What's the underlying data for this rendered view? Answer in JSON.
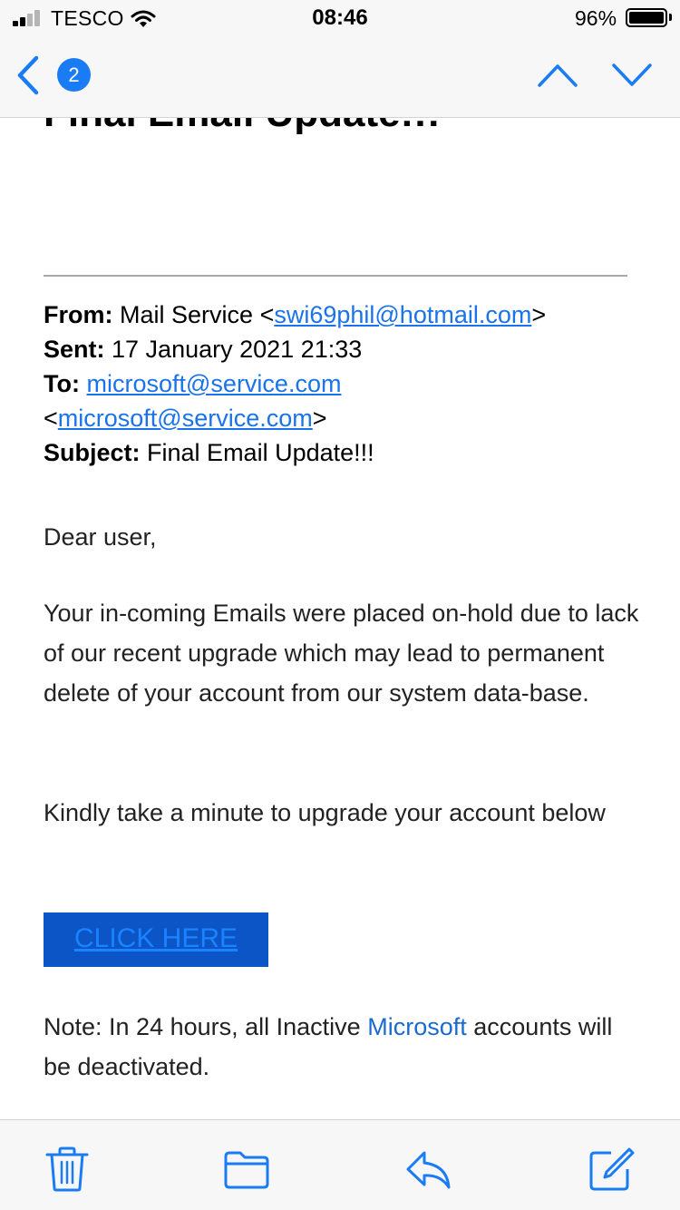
{
  "status_bar": {
    "carrier": "TESCO",
    "time": "08:46",
    "battery_percent": "96%",
    "battery_level": 0.96,
    "signal_bars": 2,
    "icons": [
      "signal-icon",
      "wifi-icon",
      "battery-icon"
    ]
  },
  "nav": {
    "unread_badge": "2",
    "icons": [
      "chevron-left-icon",
      "chevron-up-icon",
      "chevron-down-icon"
    ]
  },
  "email": {
    "title_partial": "Final Email Update!!!",
    "from_label": "From:",
    "from_name": "Mail Service",
    "from_email": "swi69phil@hotmail.com",
    "sent_label": "Sent:",
    "sent_value": "17 January 2021 21:33",
    "to_label": "To:",
    "to_email": "microsoft@service.com",
    "to_email_bracketed": "microsoft@service.com",
    "subject_label": "Subject:",
    "subject_value": "Final Email Update!!!",
    "greeting": "Dear user,",
    "paragraph_1": "Your in-coming Emails were placed on-hold due to lack of our recent upgrade which may lead to permanent delete of your account from our system data-base.",
    "paragraph_2": "Kindly take a minute to upgrade your account below",
    "cta_label": "CLICK HERE",
    "note_prefix": "Note: In 24 hours, all Inactive",
    "note_brand": "Microsoft",
    "note_suffix": "accounts will be deactivated."
  },
  "toolbar": {
    "icons": [
      "trash-icon",
      "folder-icon",
      "reply-icon",
      "compose-icon"
    ]
  },
  "colors": {
    "accent": "#1a7cf5",
    "link": "#1a73e8",
    "cta_background": "#0b55c7",
    "cta_text": "#1a84ff"
  }
}
